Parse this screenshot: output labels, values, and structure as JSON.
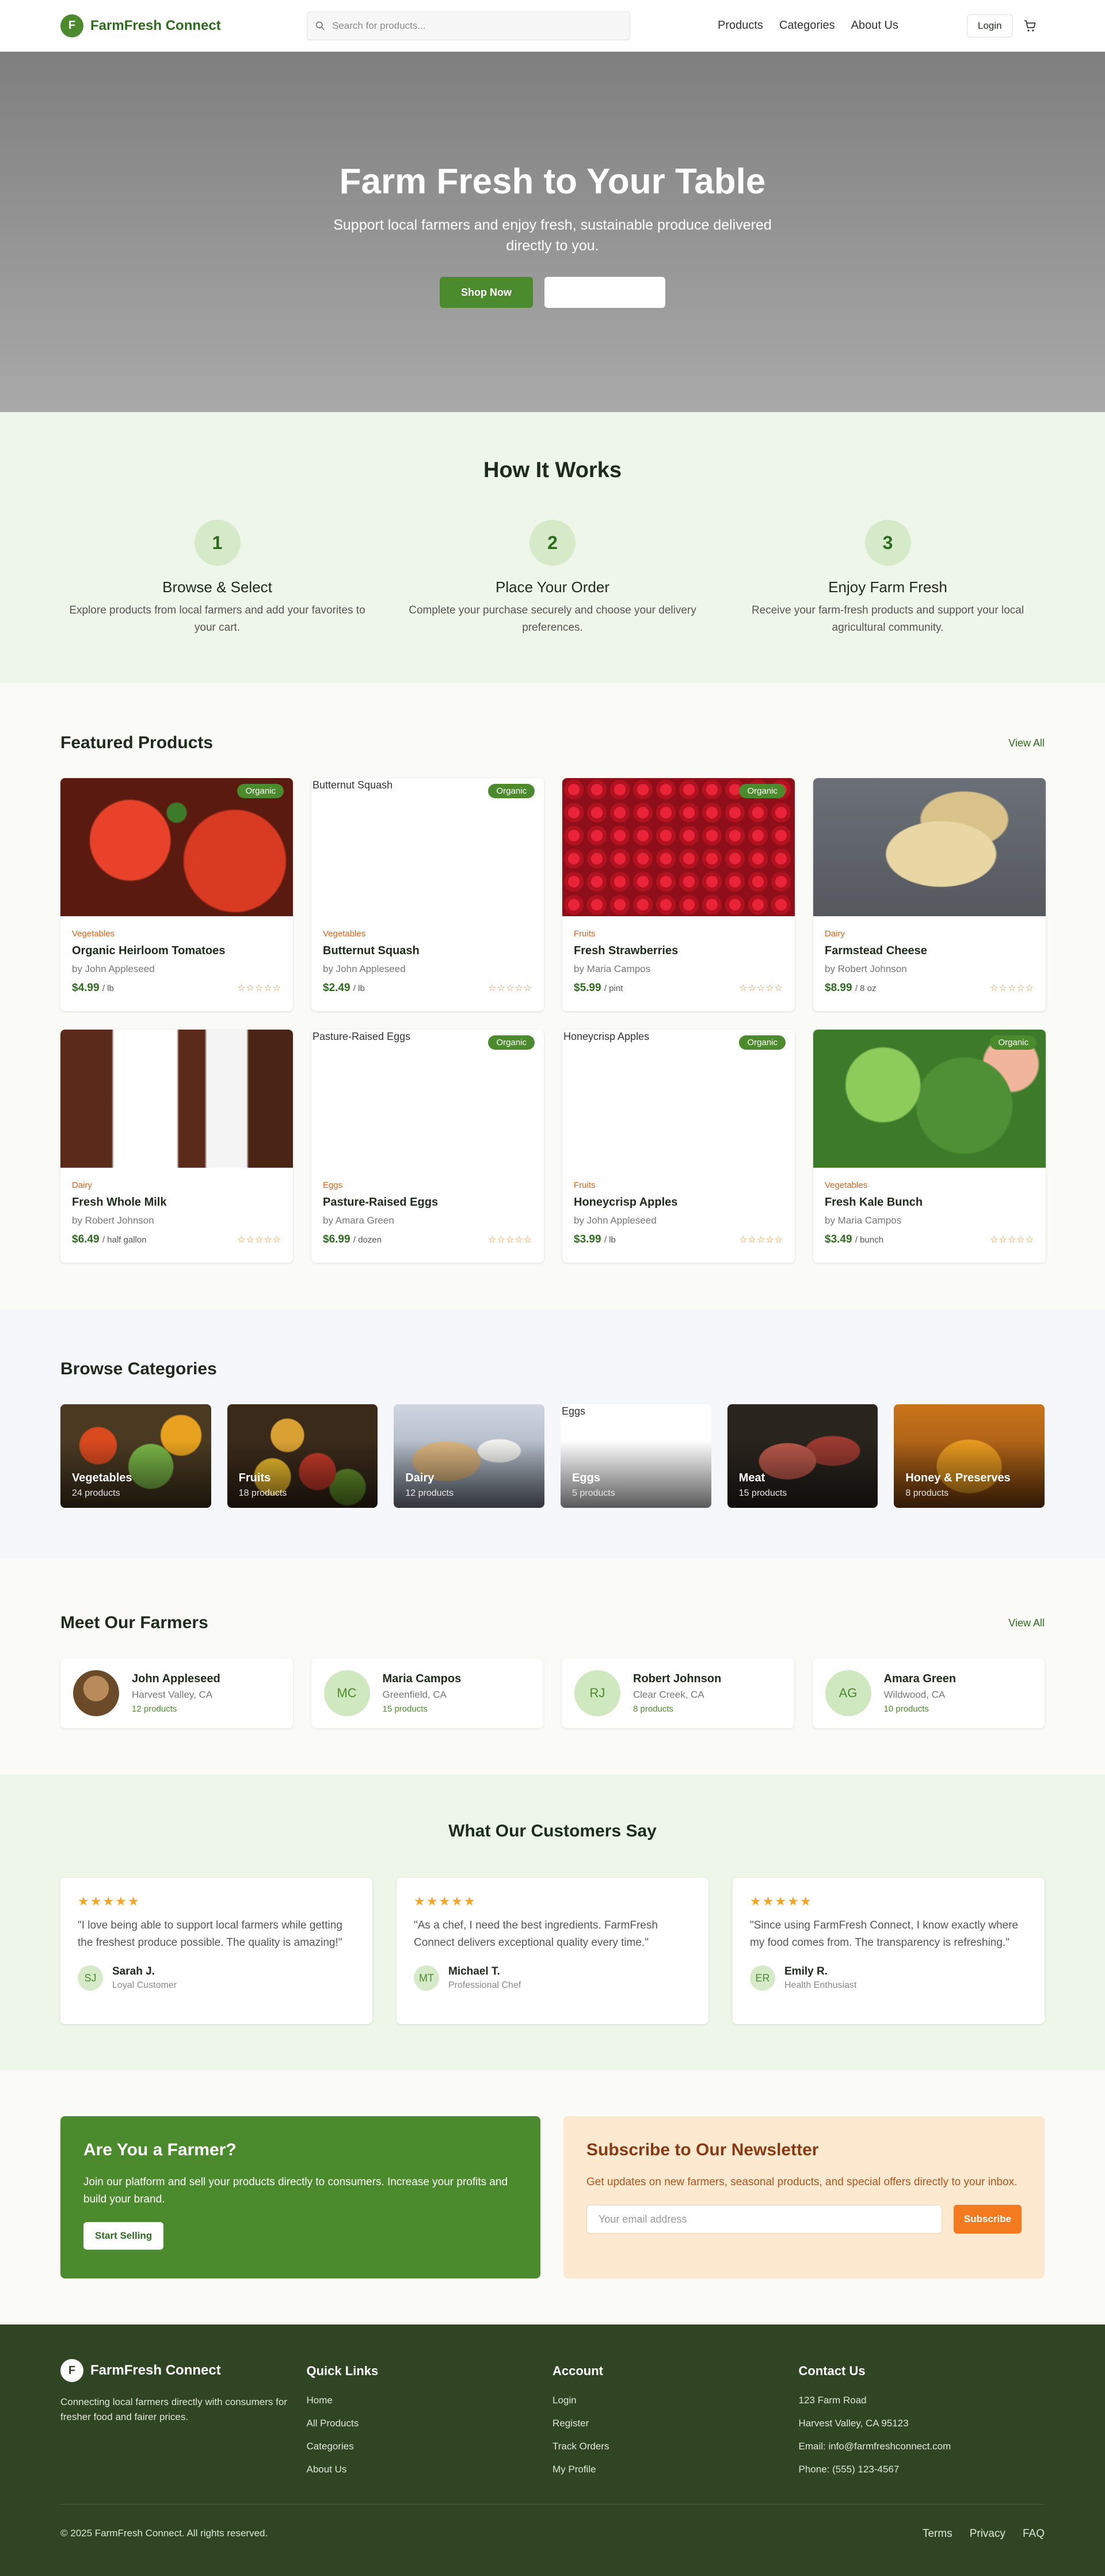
{
  "header": {
    "brand_initial": "F",
    "brand": "FarmFresh Connect",
    "search_placeholder": "Search for products...",
    "nav": [
      "Products",
      "Categories",
      "About Us"
    ],
    "login": "Login"
  },
  "hero": {
    "title": "Farm Fresh to Your Table",
    "subtitle": "Support local farmers and enjoy fresh, sustainable produce delivered directly to you.",
    "primary_cta": "Shop Now"
  },
  "how": {
    "title": "How It Works",
    "steps": [
      {
        "num": "1",
        "title": "Browse & Select",
        "text": "Explore products from local farmers and add your favorites to your cart."
      },
      {
        "num": "2",
        "title": "Place Your Order",
        "text": "Complete your purchase securely and choose your delivery preferences."
      },
      {
        "num": "3",
        "title": "Enjoy Farm Fresh",
        "text": "Receive your farm-fresh products and support your local agricultural community."
      }
    ]
  },
  "featured": {
    "title": "Featured Products",
    "view_all": "View All",
    "products": [
      {
        "category": "Vegetables",
        "name": "Organic Heirloom Tomatoes",
        "farmer": "by John Appleseed",
        "price": "$4.99",
        "unit": "/ lb",
        "tag": "Organic",
        "img_alt": "",
        "img": "tomato"
      },
      {
        "category": "Vegetables",
        "name": "Butternut Squash",
        "farmer": "by John Appleseed",
        "price": "$2.49",
        "unit": "/ lb",
        "tag": "Organic",
        "img_alt": "Butternut Squash",
        "img": "broken"
      },
      {
        "category": "Fruits",
        "name": "Fresh Strawberries",
        "farmer": "by Maria Campos",
        "price": "$5.99",
        "unit": "/ pint",
        "tag": "Organic",
        "img_alt": "",
        "img": "strawberry"
      },
      {
        "category": "Dairy",
        "name": "Farmstead Cheese",
        "farmer": "by Robert Johnson",
        "price": "$8.99",
        "unit": "/ 8 oz",
        "tag": "",
        "img_alt": "",
        "img": "cheese"
      },
      {
        "category": "Dairy",
        "name": "Fresh Whole Milk",
        "farmer": "by Robert Johnson",
        "price": "$6.49",
        "unit": "/ half gallon",
        "tag": "",
        "img_alt": "",
        "img": "milk"
      },
      {
        "category": "Eggs",
        "name": "Pasture-Raised Eggs",
        "farmer": "by Amara Green",
        "price": "$6.99",
        "unit": "/ dozen",
        "tag": "Organic",
        "img_alt": "Pasture-Raised Eggs",
        "img": "broken"
      },
      {
        "category": "Fruits",
        "name": "Honeycrisp Apples",
        "farmer": "by John Appleseed",
        "price": "$3.99",
        "unit": "/ lb",
        "tag": "Organic",
        "img_alt": "Honeycrisp Apples",
        "img": "broken"
      },
      {
        "category": "Vegetables",
        "name": "Fresh Kale Bunch",
        "farmer": "by Maria Campos",
        "price": "$3.49",
        "unit": "/ bunch",
        "tag": "Organic",
        "img_alt": "",
        "img": "kale"
      }
    ],
    "rating_stars": "☆☆☆☆☆"
  },
  "categories": {
    "title": "Browse Categories",
    "items": [
      {
        "name": "Vegetables",
        "count": "24 products",
        "img": "veg",
        "alt": ""
      },
      {
        "name": "Fruits",
        "count": "18 products",
        "img": "fruit",
        "alt": ""
      },
      {
        "name": "Dairy",
        "count": "12 products",
        "img": "dairy",
        "alt": ""
      },
      {
        "name": "Eggs",
        "count": "5 products",
        "img": "broken",
        "alt": "Eggs"
      },
      {
        "name": "Meat",
        "count": "15 products",
        "img": "meat",
        "alt": ""
      },
      {
        "name": "Honey & Preserves",
        "count": "8 products",
        "img": "honey",
        "alt": ""
      }
    ]
  },
  "farmers": {
    "title": "Meet Our Farmers",
    "view_all": "View All",
    "items": [
      {
        "initials": "",
        "name": "John Appleseed",
        "location": "Harvest Valley, CA",
        "products": "12 products",
        "photo": true
      },
      {
        "initials": "MC",
        "name": "Maria Campos",
        "location": "Greenfield, CA",
        "products": "15 products",
        "photo": false
      },
      {
        "initials": "RJ",
        "name": "Robert Johnson",
        "location": "Clear Creek, CA",
        "products": "8 products",
        "photo": false
      },
      {
        "initials": "AG",
        "name": "Amara Green",
        "location": "Wildwood, CA",
        "products": "10 products",
        "photo": false
      }
    ]
  },
  "testimonials": {
    "title": "What Our Customers Say",
    "stars": "★★★★★",
    "items": [
      {
        "quote": "\"I love being able to support local farmers while getting the freshest produce possible. The quality is amazing!\"",
        "initials": "SJ",
        "name": "Sarah J.",
        "role": "Loyal Customer"
      },
      {
        "quote": "\"As a chef, I need the best ingredients. FarmFresh Connect delivers exceptional quality every time.\"",
        "initials": "MT",
        "name": "Michael T.",
        "role": "Professional Chef"
      },
      {
        "quote": "\"Since using FarmFresh Connect, I know exactly where my food comes from. The transparency is refreshing.\"",
        "initials": "ER",
        "name": "Emily R.",
        "role": "Health Enthusiast"
      }
    ]
  },
  "cta": {
    "farmer_title": "Are You a Farmer?",
    "farmer_text": "Join our platform and sell your products directly to consumers. Increase your profits and build your brand.",
    "farmer_button": "Start Selling",
    "news_title": "Subscribe to Our Newsletter",
    "news_text": "Get updates on new farmers, seasonal products, and special offers directly to your inbox.",
    "news_placeholder": "Your email address",
    "news_button": "Subscribe"
  },
  "footer": {
    "brand_initial": "F",
    "brand": "FarmFresh Connect",
    "desc": "Connecting local farmers directly with consumers for fresher food and fairer prices.",
    "quick_title": "Quick Links",
    "quick_links": [
      "Home",
      "All Products",
      "Categories",
      "About Us"
    ],
    "account_title": "Account",
    "account_links": [
      "Login",
      "Register",
      "Track Orders",
      "My Profile"
    ],
    "contact_title": "Contact Us",
    "contact": [
      "123 Farm Road",
      "Harvest Valley, CA 95123",
      "Email: info@farmfreshconnect.com",
      "Phone: (555) 123-4567"
    ],
    "copyright": "© 2025 FarmFresh Connect. All rights reserved.",
    "legal": [
      "Terms",
      "Privacy",
      "FAQ"
    ]
  },
  "colors": {
    "brand_green": "#4c8a2e",
    "accent_orange": "#f47a1f",
    "footer_bg": "#2f4523"
  }
}
